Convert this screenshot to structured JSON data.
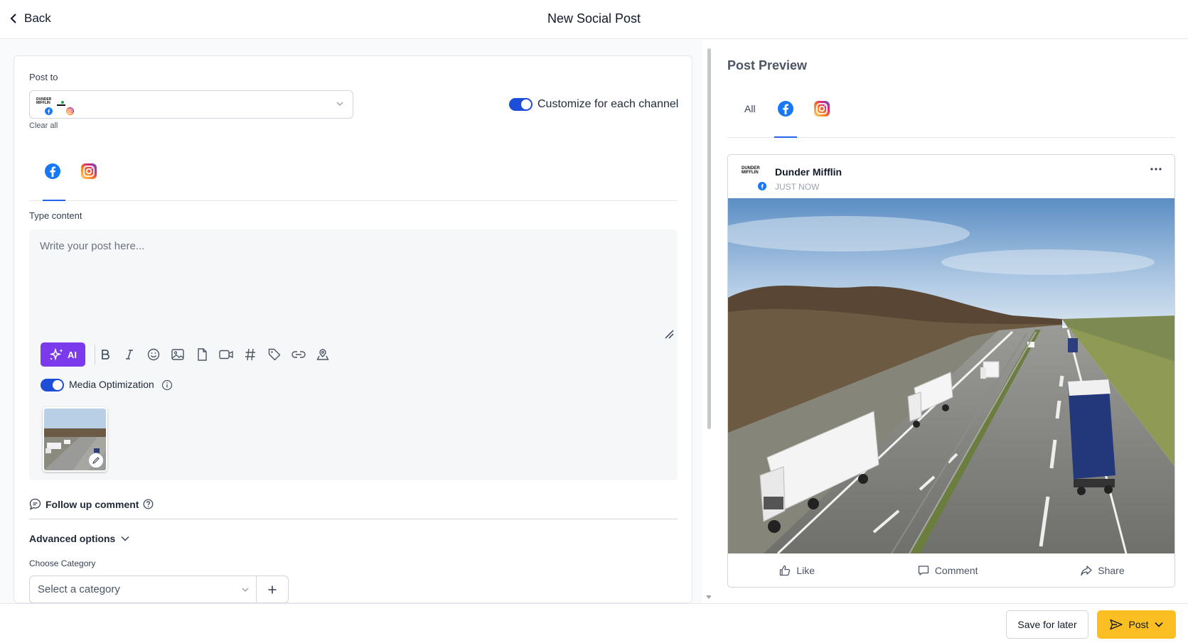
{
  "header": {
    "back_label": "Back",
    "title": "New Social Post"
  },
  "post_to": {
    "label": "Post to",
    "selected_channels": [
      {
        "logo_text": "DUNDER MIFFLIN",
        "network": "facebook"
      },
      {
        "network": "instagram"
      }
    ],
    "clear_all": "Clear all",
    "customize_toggle": {
      "label": "Customize for each channel",
      "enabled": true
    }
  },
  "channel_tabs": {
    "items": [
      "facebook-icon",
      "instagram-icon"
    ],
    "active": "facebook-icon"
  },
  "compose": {
    "type_content_label": "Type content",
    "placeholder": "Write your post here...",
    "value": "",
    "ai_label": "AI",
    "toolbar": [
      "bold-icon",
      "italic-icon",
      "emoji-icon",
      "image-icon",
      "document-icon",
      "video-icon",
      "hashtag-icon",
      "tag-icon",
      "link-icon",
      "location-icon"
    ],
    "media_optimization": {
      "label": "Media Optimization",
      "enabled": true
    }
  },
  "follow_up": {
    "label": "Follow up comment"
  },
  "advanced": {
    "label": "Advanced options"
  },
  "category": {
    "label": "Choose Category",
    "placeholder": "Select a category"
  },
  "preview": {
    "title": "Post Preview",
    "tabs": [
      {
        "label": "All"
      },
      {
        "icon": "facebook-icon"
      },
      {
        "icon": "instagram-icon"
      }
    ],
    "active_tab": "facebook-icon",
    "card": {
      "author": "Dunder Mifflin",
      "avatar_text": "DUNDER MIFFLIN",
      "time": "JUST NOW",
      "actions": [
        "Like",
        "Comment",
        "Share"
      ]
    }
  },
  "footer": {
    "save_later": "Save for later",
    "post": "Post"
  },
  "colors": {
    "accent": "#2563eb",
    "ai_purple": "#7c3aed",
    "post_yellow": "#fbbf24",
    "facebook": "#1877f2"
  }
}
